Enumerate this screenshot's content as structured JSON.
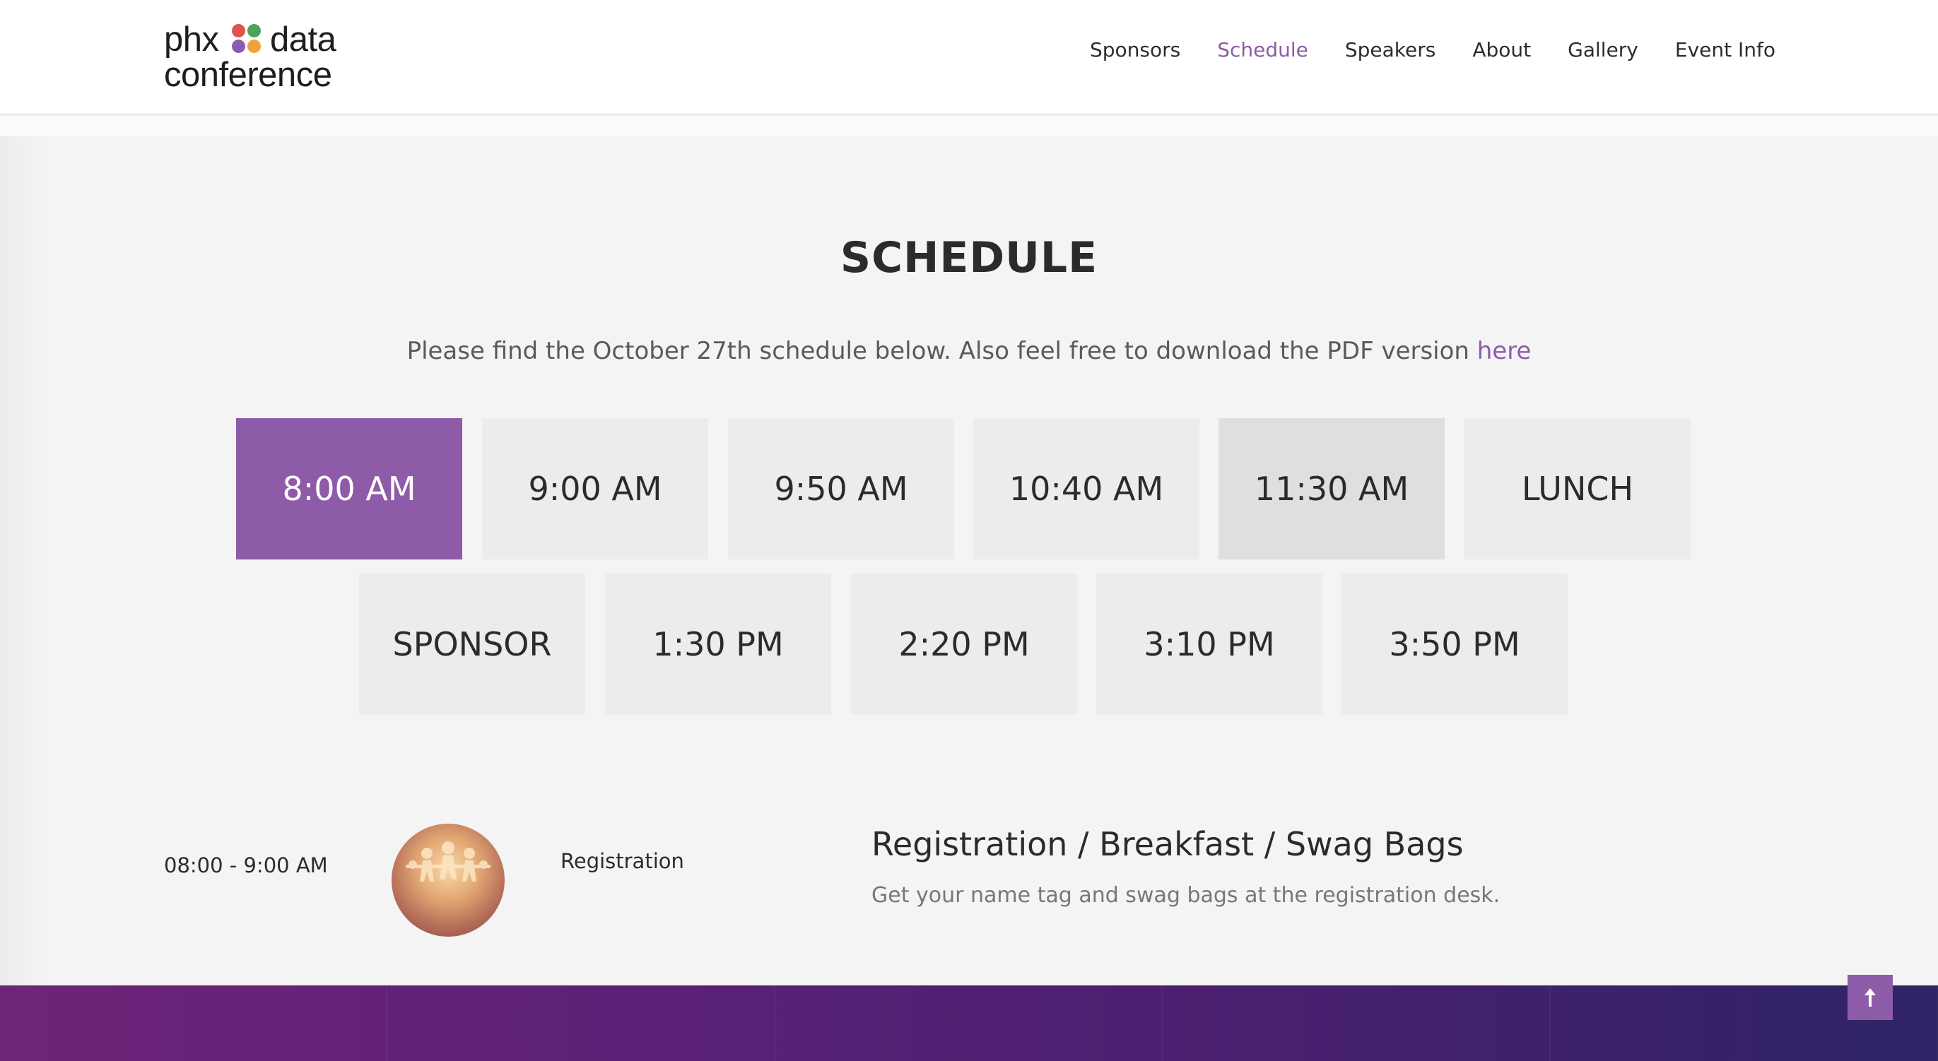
{
  "header": {
    "logo": {
      "word1": "phx",
      "word2": "data",
      "word3": "conference",
      "dot_colors": [
        "#e0534a",
        "#4ea35a",
        "#8a5bb5",
        "#f0a33c"
      ]
    },
    "nav": [
      {
        "label": "Sponsors"
      },
      {
        "label": "Schedule",
        "active": true
      },
      {
        "label": "Speakers"
      },
      {
        "label": "About"
      },
      {
        "label": "Gallery"
      },
      {
        "label": "Event Info"
      }
    ]
  },
  "main": {
    "title": "SCHEDULE",
    "subtitle_text": "Please find the October 27th schedule below. Also feel free to download the PDF version ",
    "subtitle_link": "here",
    "tabs": [
      {
        "label": "8:00 AM",
        "state": "active"
      },
      {
        "label": "9:00 AM"
      },
      {
        "label": "9:50 AM"
      },
      {
        "label": "10:40 AM"
      },
      {
        "label": "11:30 AM",
        "state": "hover"
      },
      {
        "label": "LUNCH"
      },
      {
        "label": "SPONSOR"
      },
      {
        "label": "1:30 PM"
      },
      {
        "label": "2:20 PM"
      },
      {
        "label": "3:10 PM"
      },
      {
        "label": "3:50 PM"
      }
    ],
    "session": {
      "time": "08:00 - 9:00 AM",
      "category": "Registration",
      "title": "Registration / Breakfast / Swag Bags",
      "description": "Get your name tag and swag bags at the registration desk."
    }
  },
  "colors": {
    "accent": "#8e5ba8",
    "footer_start": "#6e2479",
    "footer_end": "#2e2466"
  },
  "back_to_top": {
    "icon": "arrow-up-icon"
  }
}
